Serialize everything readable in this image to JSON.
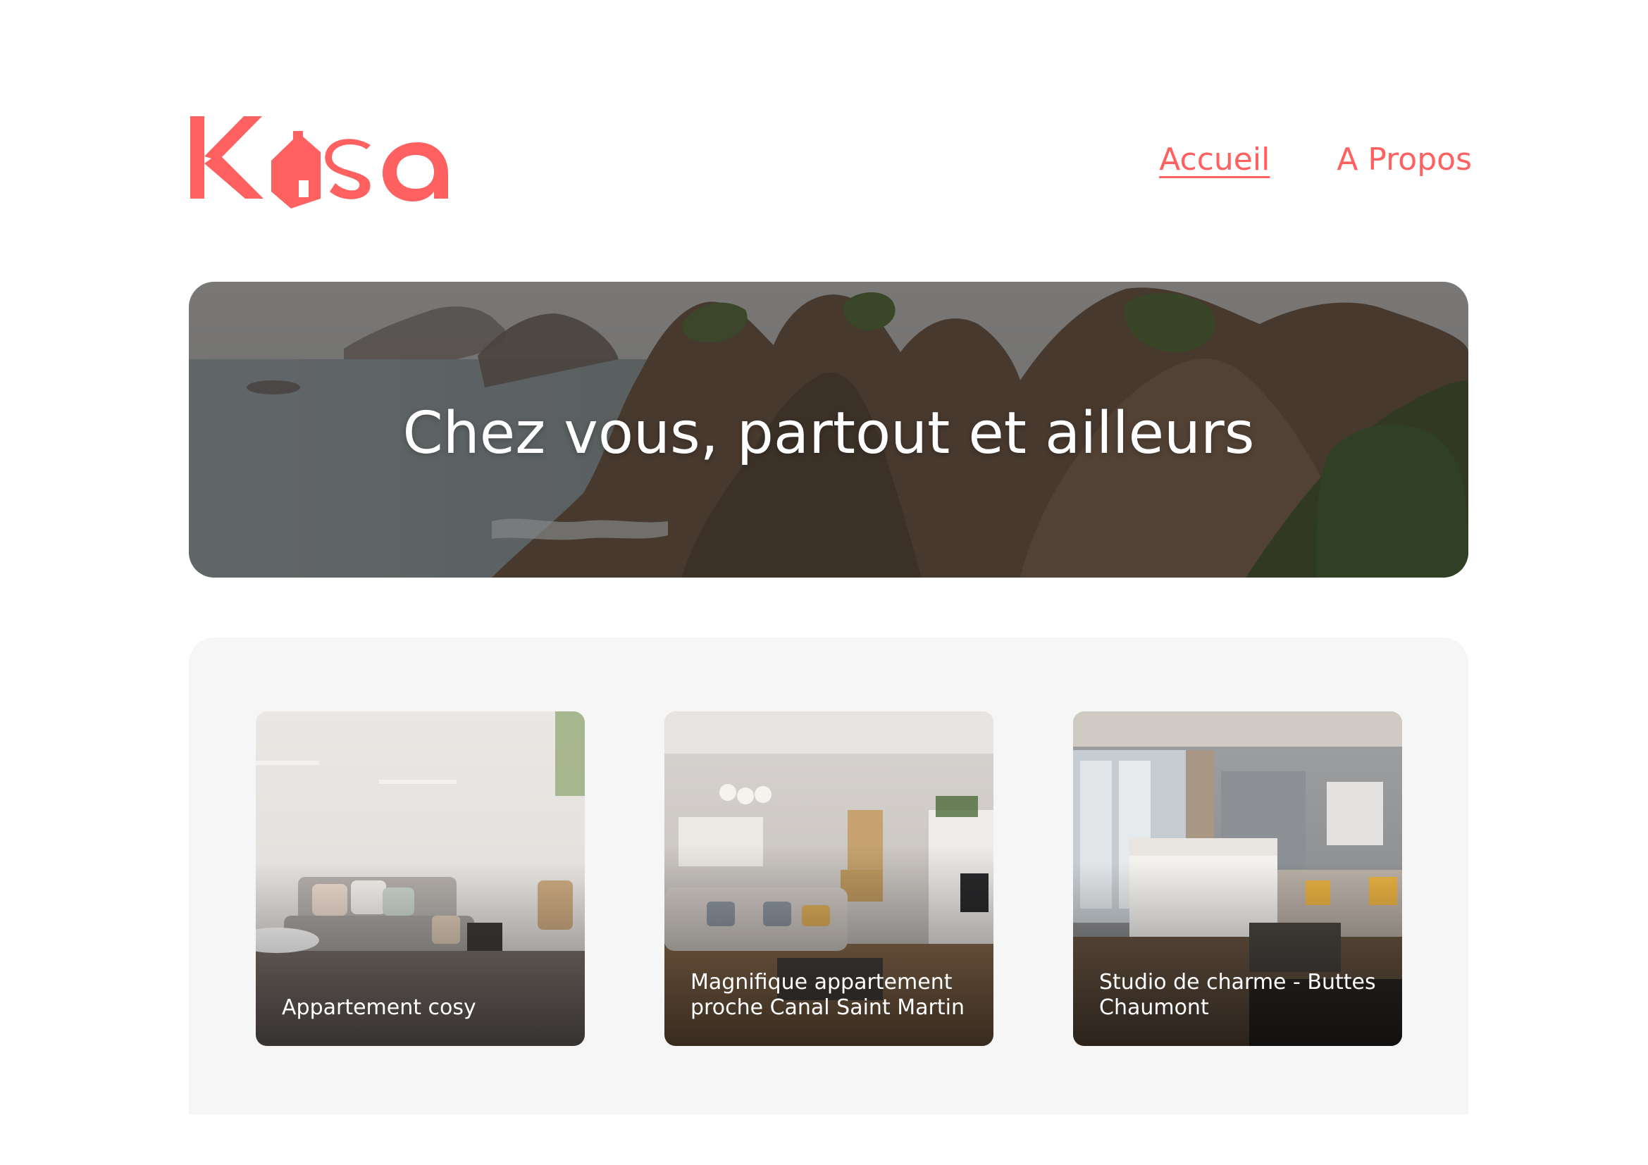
{
  "brand": {
    "name": "Kasa",
    "color": "#FF6060"
  },
  "nav": {
    "items": [
      {
        "label": "Accueil",
        "active": true
      },
      {
        "label": "A Propos",
        "active": false
      }
    ]
  },
  "banner": {
    "title": "Chez vous, partout et ailleurs"
  },
  "gallery": {
    "background": "#F6F6F6",
    "cards": [
      {
        "title": "Appartement cosy"
      },
      {
        "title": "Magnifique appartement proche Canal Saint Martin"
      },
      {
        "title": "Studio de charme - Buttes Chaumont"
      }
    ]
  }
}
